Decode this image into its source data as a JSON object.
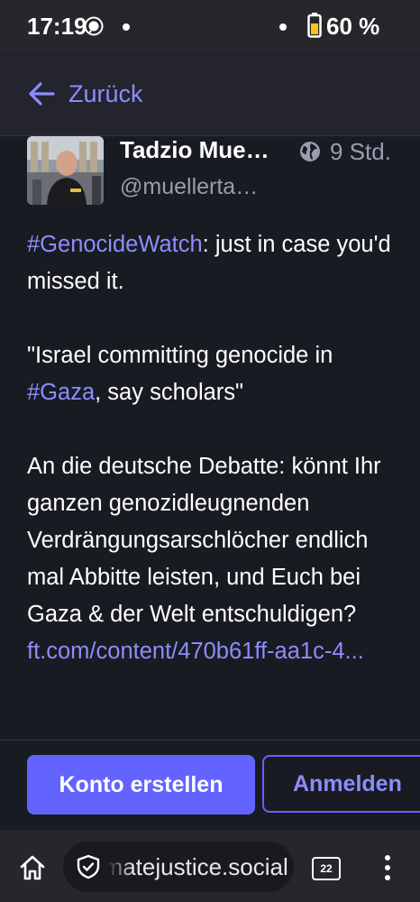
{
  "status_bar": {
    "time": "17:19",
    "battery": "60 %"
  },
  "header": {
    "back_label": "Zurück"
  },
  "post": {
    "author_name": "Tadzio Mueller",
    "author_handle": "@muellertadzio",
    "time": "9 Std.",
    "body": {
      "hashtag_1": "#GenocideWatch",
      "line_1_rest": ": just in case you'd missed it.",
      "quote_start": "\"Israel committing genocide in ",
      "hashtag_2": "#Gaza",
      "quote_end": ", say scholars\"",
      "paragraph_3": "An die deutsche Debatte: könnt Ihr ganzen genozidleugnenden Verdrängungsarschlöcher endlich mal Abbitte leisten, und Euch bei Gaza & der Welt entschuldigen?",
      "link_text": "ft.com/content/470b61ff-aa1c-4..."
    }
  },
  "actions": {
    "create_account": "Konto erstellen",
    "login": "Anmelden"
  },
  "browser": {
    "url": "climatejustice.social",
    "tab_count": "22"
  },
  "colors": {
    "accent": "#6364ff",
    "link": "#8c8dff",
    "background": "#191b22"
  },
  "icons": [
    "signal-icon",
    "battery-icon",
    "back-arrow-icon",
    "globe-icon",
    "home-icon",
    "shield-icon",
    "tabs-icon",
    "menu-icon"
  ]
}
